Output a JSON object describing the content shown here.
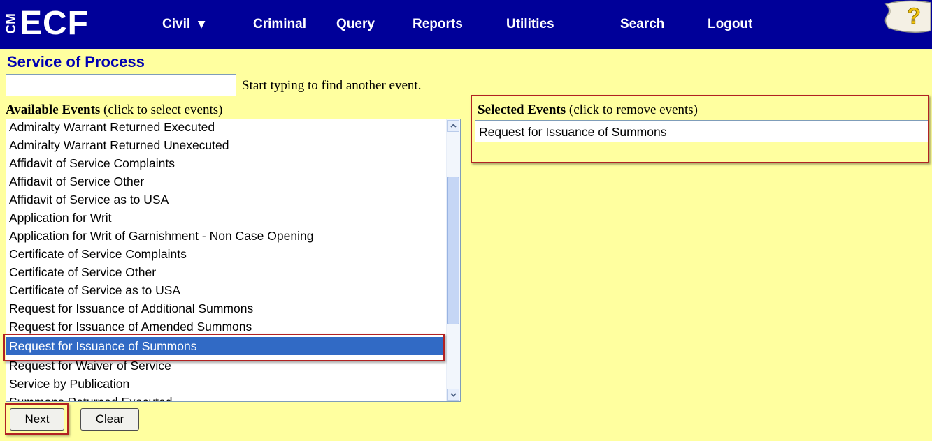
{
  "logo": {
    "cm": "CM",
    "ecf": "ECF"
  },
  "nav": {
    "civil": "Civil",
    "civil_caret": "▾",
    "criminal": "Criminal",
    "query": "Query",
    "reports": "Reports",
    "utilities": "Utilities",
    "search": "Search",
    "logout": "Logout"
  },
  "help": {
    "glyph": "?"
  },
  "page": {
    "title": "Service of Process"
  },
  "finder": {
    "value": "",
    "hint": "Start typing to find another event."
  },
  "available": {
    "heading_bold": "Available Events",
    "heading_rest": " (click to select events)",
    "items": [
      "Admiralty Warrant Returned Executed",
      "Admiralty Warrant Returned Unexecuted",
      "Affidavit of Service Complaints",
      "Affidavit of Service Other",
      "Affidavit of Service as to USA",
      "Application for Writ",
      "Application for Writ of Garnishment - Non Case Opening",
      "Certificate of Service Complaints",
      "Certificate of Service Other",
      "Certificate of Service as to USA",
      "Request for Issuance of Additional Summons",
      "Request for Issuance of Amended Summons",
      "Request for Issuance of Summons",
      "Request for Waiver of Service",
      "Service by Publication",
      "Summons Returned Executed"
    ],
    "selected_index": 12
  },
  "selected": {
    "heading_bold": "Selected Events",
    "heading_rest": " (click to remove events)",
    "items": [
      "Request for Issuance of Summons"
    ]
  },
  "buttons": {
    "next": "Next",
    "clear": "Clear"
  },
  "colors": {
    "background": "#ffff9f",
    "nav_bar": "#000099",
    "title": "#0000b3",
    "selection": "#316ac5",
    "highlight_frame": "#b22222"
  }
}
